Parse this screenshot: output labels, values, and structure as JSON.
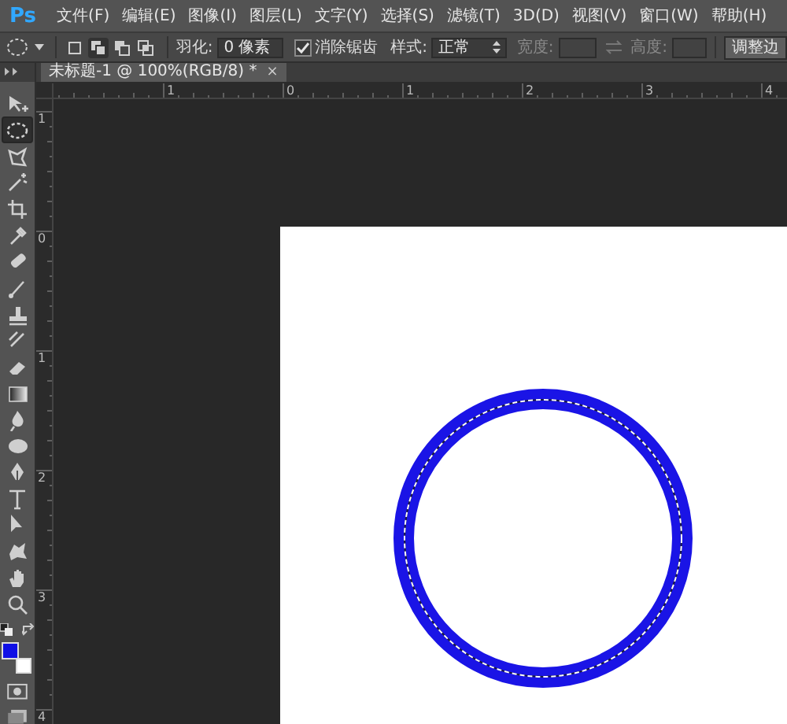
{
  "menu_bar": {
    "logo": "Ps",
    "items": [
      "文件(F)",
      "编辑(E)",
      "图像(I)",
      "图层(L)",
      "文字(Y)",
      "选择(S)",
      "滤镜(T)",
      "3D(D)",
      "视图(V)",
      "窗口(W)",
      "帮助(H)"
    ]
  },
  "options_bar": {
    "selection_modes": [
      {
        "selected": false
      },
      {
        "selected": true
      },
      {
        "selected": false
      },
      {
        "selected": false
      }
    ],
    "feather_label": "羽化:",
    "feather_value": "0 像素",
    "anti_alias": {
      "label": "消除锯齿",
      "checked": true
    },
    "style_label": "样式:",
    "style_value": "正常",
    "width_label": "宽度:",
    "height_label": "高度:",
    "size_fields_disabled": true,
    "refine_button": "调整边"
  },
  "document_tab": {
    "title": "未标题-1 @ 100%(RGB/8) *",
    "close": "×"
  },
  "toolbar": {
    "tools": [
      {
        "selected": false
      },
      {
        "selected": true
      },
      {
        "selected": false
      },
      {
        "selected": false
      },
      {
        "selected": false
      },
      {
        "selected": false
      },
      {
        "selected": false
      },
      {
        "selected": false
      },
      {
        "selected": false
      },
      {
        "selected": false
      },
      {
        "selected": false
      },
      {
        "selected": false
      },
      {
        "selected": false
      },
      {
        "selected": false
      },
      {
        "selected": false
      },
      {
        "selected": false
      },
      {
        "selected": false
      },
      {
        "selected": false
      },
      {
        "selected": false
      },
      {
        "selected": false
      }
    ],
    "swatches": [
      {
        "color": "#1010e6"
      },
      {
        "color": "#ffffff"
      }
    ]
  },
  "top_ruler": [
    "1",
    "0",
    "1",
    "2",
    "3",
    "4"
  ],
  "left_ruler": [
    "1",
    "0",
    "1",
    "2",
    "3",
    "4"
  ]
}
